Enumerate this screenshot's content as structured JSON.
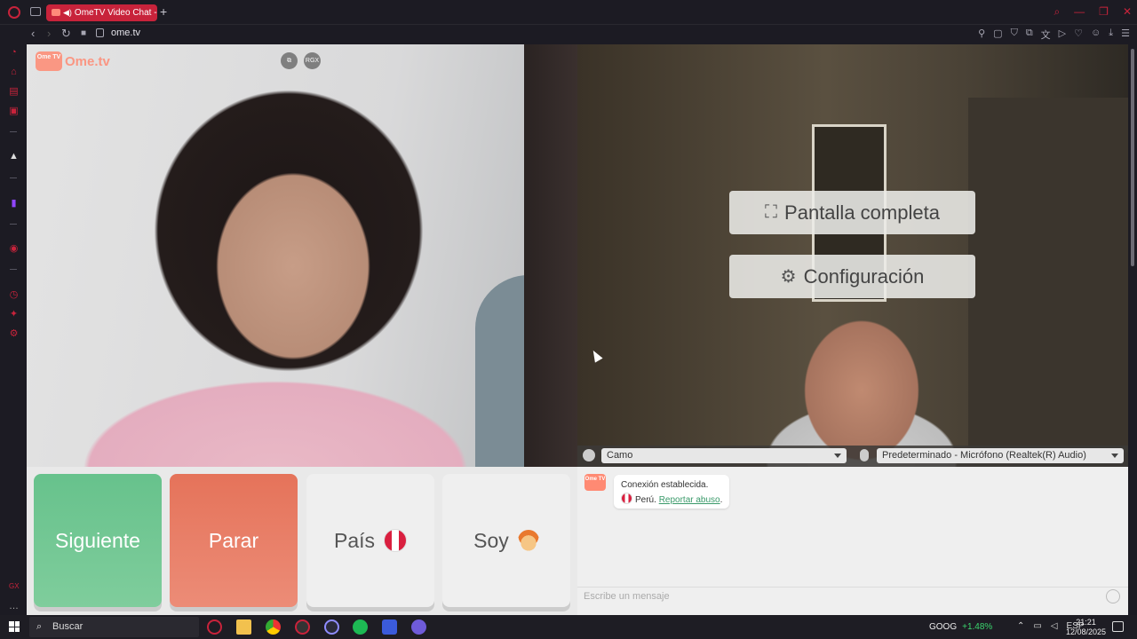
{
  "browser": {
    "tab_title": "OmeTV Video Chat -...",
    "tab_add": "+",
    "url": "ome.tv"
  },
  "logo": {
    "badge": "Ome TV",
    "text": "Ome.tv"
  },
  "video": {
    "btn_mirror": "⧉",
    "btn_rgx": "RGX"
  },
  "overlay": {
    "fullscreen_label": "Pantalla completa",
    "settings_label": "Configuración"
  },
  "devices": {
    "camera": "Camo",
    "microphone": "Predeterminado - Micrófono (Realtek(R) Audio)"
  },
  "controls": {
    "next_label": "Siguiente",
    "stop_label": "Parar",
    "country_label": "País",
    "gender_label": "Soy"
  },
  "chat": {
    "logo_badge": "Ome TV",
    "status": "Conexión establecida.",
    "country": "Perú.",
    "report_link": "Reportar abuso",
    "report_suffix": ".",
    "input_placeholder": "Escribe un mensaje"
  },
  "taskbar": {
    "search_label": "Buscar",
    "stock_symbol": "GOOG",
    "stock_change": "+1.48%",
    "language": "ESP",
    "time": "21:21",
    "date": "12/08/2025"
  },
  "colors": {
    "accent": "#c8233b",
    "next": "#67c28c",
    "stop": "#e5735a"
  }
}
